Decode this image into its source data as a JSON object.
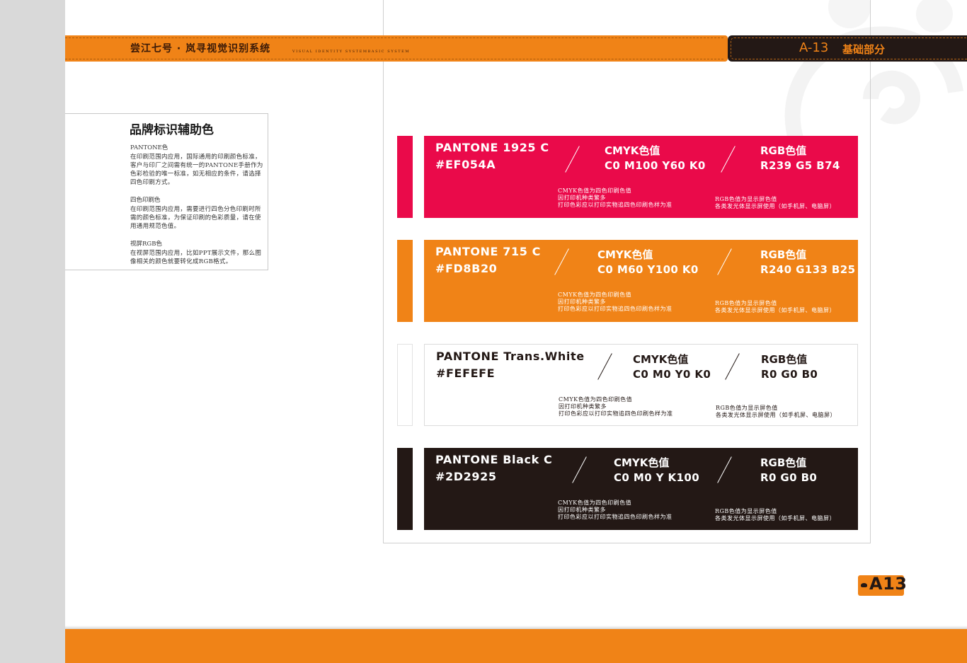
{
  "header": {
    "title": "尝江七号 · 岚寻视觉识别系统",
    "subtitle": "VISUAL IDENTITY SYSTEMBASIC SYSTEM",
    "page_code": "A-13",
    "section": "基础部分"
  },
  "description": {
    "title": "品牌标识辅助色",
    "blocks": [
      {
        "label": "PANTONE色",
        "text": "在印刷范围内应用，国际通用的印刷颜色标准，客户与印厂之间需有统一的PANTONE手册作为色彩检验的唯一标准，如无相应的条件，请选择四色印刷方式。"
      },
      {
        "label": "四色印刷色",
        "text": "在印刷范围内应用，需要进行四色分色印刷时所需的颜色标准，为保证印刷的色彩质量，请在使用通用规范色值。"
      },
      {
        "label": "视屏RGB色",
        "text": "在视屏范围内应用，比如PPT展示文件，那么图像相关的颜色就要转化成RGB格式。"
      }
    ]
  },
  "swatches": [
    {
      "pantone": "PANTONE 1925 C",
      "hex": "#EF054A",
      "cmyk_title": "CMYK色值",
      "cmyk_value": "C0 M100 Y60 K0",
      "rgb_title": "RGB色值",
      "rgb_value": "R239 G5 B74",
      "cmyk_note": [
        "CMYK色值为四色印刷色值",
        "因打印机种类繁多",
        "打印色彩应以打印实物追四色印刷色样为准"
      ],
      "rgb_note": [
        "RGB色值为显示屏色值",
        "各类发光体显示屏使用（如手机屏、电脑屏）"
      ],
      "fill": "#ea0a4a",
      "text_color": "#ffffff"
    },
    {
      "pantone": "PANTONE 715 C",
      "hex": "#FD8B20",
      "cmyk_title": "CMYK色值",
      "cmyk_value": "C0 M60 Y100 K0",
      "rgb_title": "RGB色值",
      "rgb_value": "R240 G133 B25",
      "cmyk_note": [
        "CMYK色值为四色印刷色值",
        "因打印机种类繁多",
        "打印色彩应以打印实物追四色印刷色样为准"
      ],
      "rgb_note": [
        "RGB色值为显示屏色值",
        "各类发光体显示屏使用（如手机屏、电脑屏）"
      ],
      "fill": "#f08317",
      "text_color": "#ffffff"
    },
    {
      "pantone": "PANTONE Trans.White",
      "hex": "#FEFEFE",
      "cmyk_title": "CMYK色值",
      "cmyk_value": "C0 M0 Y0 K0",
      "rgb_title": "RGB色值",
      "rgb_value": "R0 G0 B0",
      "cmyk_note": [
        "CMYK色值为四色印刷色值",
        "因打印机种类繁多",
        "打印色彩应以打印实物追四色印刷色样为准"
      ],
      "rgb_note": [
        "RGB色值为显示屏色值",
        "各类发光体显示屏使用（如手机屏、电脑屏）"
      ],
      "fill": "#ffffff",
      "text_color": "#231815"
    },
    {
      "pantone": "PANTONE Black C",
      "hex": "#2D2925",
      "cmyk_title": "CMYK色值",
      "cmyk_value": "C0 M0 Y K100",
      "rgb_title": "RGB色值",
      "rgb_value": "R0 G0 B0",
      "cmyk_note": [
        "CMYK色值为四色印刷色值",
        "因打印机种类繁多",
        "打印色彩应以打印实物追四色印刷色样为准"
      ],
      "rgb_note": [
        "RGB色值为显示屏色值",
        "各类发光体显示屏使用（如手机屏、电脑屏）"
      ],
      "fill": "#231815",
      "text_color": "#ffffff"
    }
  ],
  "badge": {
    "label": "A13"
  },
  "colors": {
    "brand_orange": "#f08317",
    "brand_dark": "#231815"
  }
}
